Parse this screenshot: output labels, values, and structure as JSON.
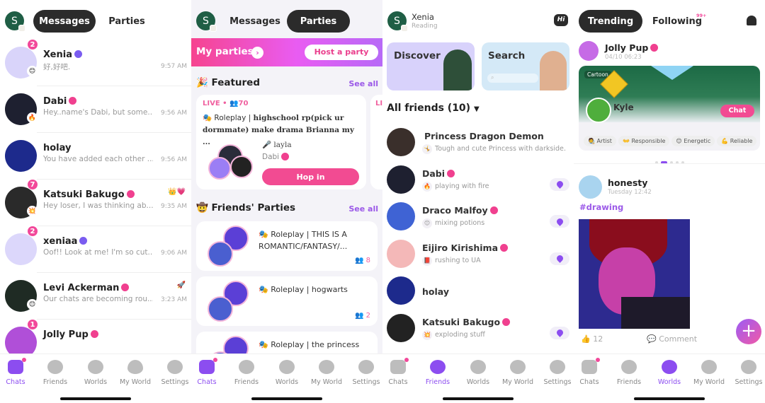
{
  "self_avatar_letter": "S",
  "panel1": {
    "tabs": [
      "Messages",
      "Parties"
    ],
    "active_tab": "Messages",
    "chats": [
      {
        "name": "Xenia",
        "verified": "purple",
        "message": "好,好吧.",
        "time": "9:57 AM",
        "unread": "2",
        "status_emoji": "😊"
      },
      {
        "name": "Dabi",
        "verified": "pink",
        "message": "Hey..name's Dabi, but some...",
        "time": "9:56 AM",
        "unread": "",
        "status_emoji": "🔥"
      },
      {
        "name": "holay",
        "verified": "",
        "message": "You have added each other ...",
        "time": "9:56 AM",
        "unread": "",
        "status_emoji": ""
      },
      {
        "name": "Katsuki Bakugo",
        "verified": "pink",
        "message": "Hey loser, I was thinking ab...",
        "time": "9:35 AM",
        "unread": "7",
        "status_emoji": "💥",
        "tags": "👑💗"
      },
      {
        "name": "xeniaa",
        "verified": "purple",
        "message": "Oof!! Look at me! I'm so cut...",
        "time": "9:06 AM",
        "unread": "2",
        "status_emoji": ""
      },
      {
        "name": "Levi Ackerman",
        "verified": "pink",
        "message": "Our chats are becoming rou...",
        "time": "3:23 AM",
        "unread": "",
        "status_emoji": "😊",
        "tags": "🚀"
      },
      {
        "name": "Jolly Pup",
        "verified": "pink",
        "message": "",
        "time": "",
        "unread": "1",
        "status_emoji": ""
      }
    ]
  },
  "panel2": {
    "tabs": [
      "Messages",
      "Parties"
    ],
    "active_tab": "Parties",
    "my_parties_label": "My parties",
    "host_party_label": "Host a party",
    "featured": {
      "title": "Featured",
      "see_all": "See all",
      "live_label": "LIVE",
      "listeners": "70",
      "category": "Roleplay |",
      "party_title": "highschool rp(pick ur dormmate) make drama Brianna my ...",
      "host": "layla",
      "member": "Dabi",
      "hop_in": "Hop in",
      "next_live": "LI"
    },
    "friends_parties": {
      "title": "Friends' Parties",
      "see_all": "See all",
      "items": [
        {
          "title": "Roleplay | THIS IS A ROMANTIC/FANTASY/...",
          "count": "8"
        },
        {
          "title": "Roleplay | hogwarts",
          "count": "2"
        },
        {
          "title": "Roleplay | the princess",
          "count": ""
        }
      ]
    }
  },
  "panel3": {
    "user_name": "Xenia",
    "user_status": "Reading",
    "hi_label": "Hi",
    "discover_label": "Discover",
    "search_label": "Search",
    "friends_header": "All friends (10)",
    "friends": [
      {
        "name": "Princess Dragon Demon",
        "verified": "",
        "status": "Tough and cute Princess with darkside.",
        "emoji": "🤸",
        "has_location": false
      },
      {
        "name": "Dabi",
        "verified": "pink",
        "status": "playing with fire",
        "emoji": "🔥",
        "has_location": true
      },
      {
        "name": "Draco Malfoy",
        "verified": "pink",
        "status": "mixing potions",
        "emoji": "😊",
        "has_location": true
      },
      {
        "name": "Eijiro Kirishima",
        "verified": "pink",
        "status": "rushing to UA",
        "emoji": "📕",
        "has_location": true
      },
      {
        "name": "holay",
        "verified": "",
        "status": "",
        "emoji": "",
        "has_location": false
      },
      {
        "name": "Katsuki Bakugo",
        "verified": "pink",
        "status": "exploding stuff",
        "emoji": "💥",
        "has_location": true
      }
    ]
  },
  "panel4": {
    "tabs": [
      "Trending",
      "Following"
    ],
    "active_tab": "Trending",
    "following_badge": "99+",
    "post1": {
      "author": "Jolly Pup",
      "time": "04/10 06:23",
      "card_tag": "Cartoon",
      "character": "Kyle",
      "chat_label": "Chat",
      "traits": [
        "Artist",
        "Responsible",
        "Energetic",
        "Reliable"
      ],
      "trait_emojis": [
        "🧑‍🎨",
        "👐",
        "😊",
        "💪"
      ],
      "carousel_pages": 5,
      "carousel_active": 2
    },
    "post2": {
      "author": "honesty",
      "time": "Tuesday 12:42",
      "hashtag": "#drawing",
      "likes": "12",
      "comment_label": "Comment"
    }
  },
  "tabbar": {
    "labels": [
      "Chats",
      "Friends",
      "Worlds",
      "My World",
      "Settings"
    ]
  },
  "colors": {
    "accent_purple": "#8c4df0",
    "accent_pink": "#f24b92",
    "dark_pill": "#2b2b2b"
  }
}
